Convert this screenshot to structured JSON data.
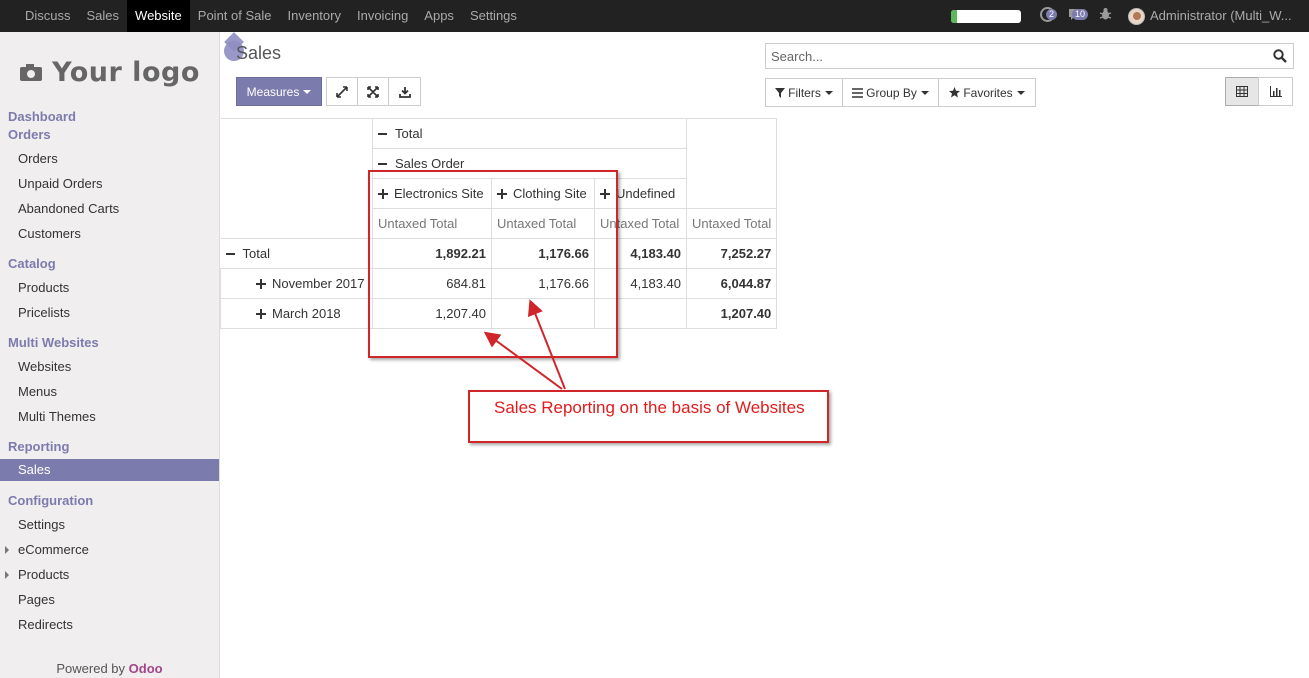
{
  "topbar": {
    "menu": [
      "Discuss",
      "Sales",
      "Website",
      "Point of Sale",
      "Inventory",
      "Invoicing",
      "Apps",
      "Settings"
    ],
    "active": "Website",
    "progress_fraction": 0.08,
    "messages_badge": "2",
    "activities_badge": "10",
    "user": "Administrator (Multi_W..."
  },
  "sidebar": {
    "logo_text": "Your logo",
    "dashboard": "Dashboard",
    "orders_head": "Orders",
    "orders_items": [
      "Orders",
      "Unpaid Orders",
      "Abandoned Carts",
      "Customers"
    ],
    "catalog_head": "Catalog",
    "catalog_items": [
      "Products",
      "Pricelists"
    ],
    "multi_head": "Multi Websites",
    "multi_items": [
      "Websites",
      "Menus",
      "Multi Themes"
    ],
    "reporting_head": "Reporting",
    "reporting_items": [
      "Sales"
    ],
    "config_head": "Configuration",
    "config_items": [
      "Settings",
      "eCommerce",
      "Products",
      "Pages",
      "Redirects"
    ],
    "powered_prefix": "Powered by ",
    "powered_brand": "Odoo"
  },
  "control": {
    "title": "Sales",
    "measures": "Measures",
    "search_placeholder": "Search...",
    "filters": "Filters",
    "group_by": "Group By",
    "favorites": "Favorites"
  },
  "pivot": {
    "col_total": "Total",
    "col_group": "Sales Order",
    "col_sites": [
      "Electronics Site",
      "Clothing Site",
      "Undefined"
    ],
    "measure": "Untaxed Total",
    "row_total_label": "Total",
    "row_total_values": [
      "1,892.21",
      "1,176.66",
      "4,183.40",
      "7,252.27"
    ],
    "rows": [
      {
        "label": "November 2017",
        "values": [
          "684.81",
          "1,176.66",
          "4,183.40",
          "6,044.87"
        ]
      },
      {
        "label": "March 2018",
        "values": [
          "1,207.40",
          "",
          "",
          "1,207.40"
        ]
      }
    ]
  },
  "annotation": {
    "text": "Sales Reporting on the basis of Websites",
    "color": "#d0262a"
  },
  "colors": {
    "brand": "#7c7bad",
    "topbar": "#222222"
  }
}
